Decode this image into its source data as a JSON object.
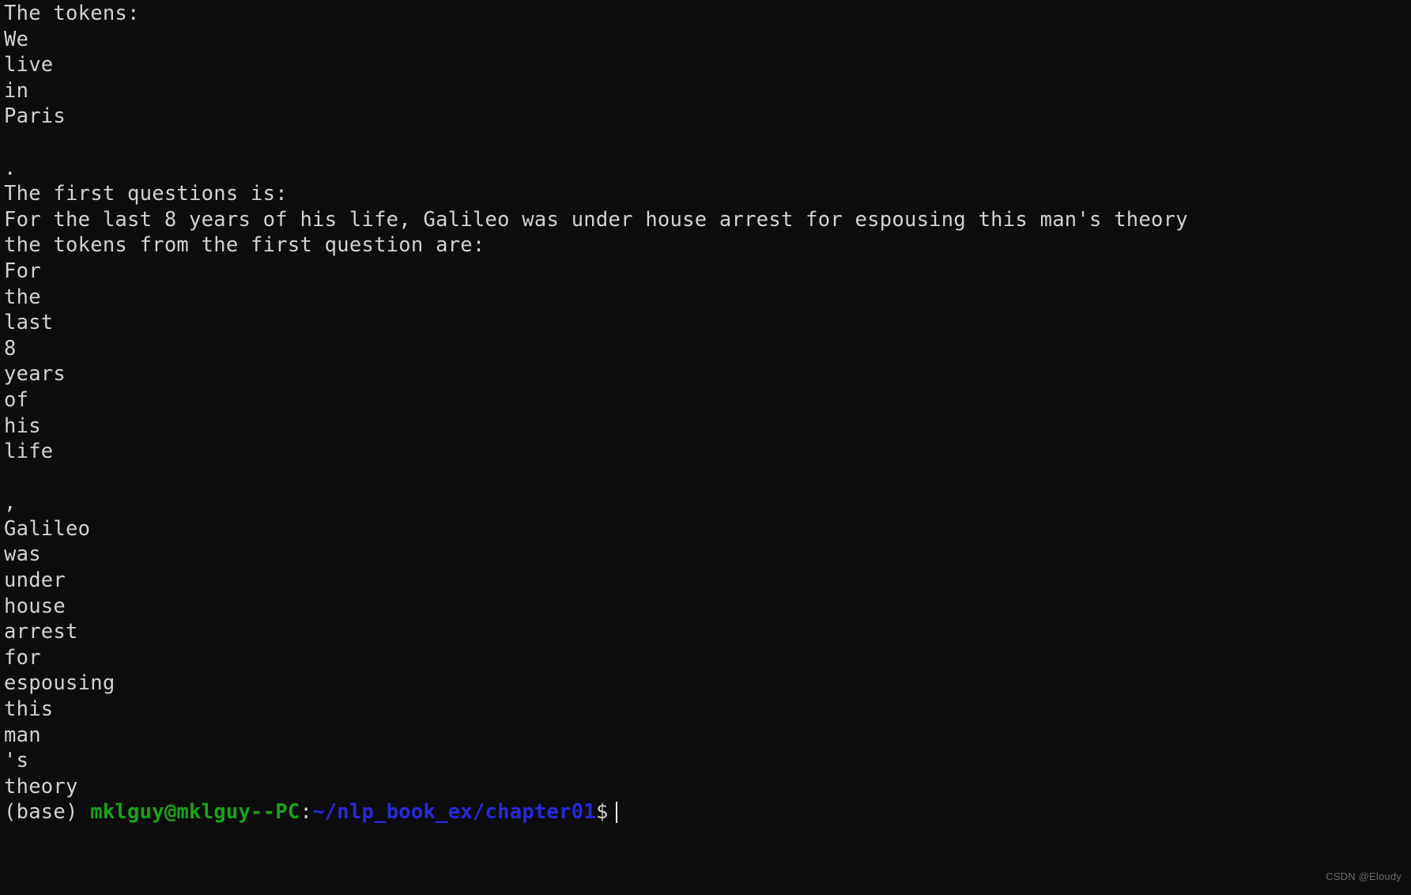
{
  "terminal": {
    "background_color": "#0d0d0d",
    "text_color": "#d2d2d2",
    "user_host_color": "#19a319",
    "path_color": "#2828e0",
    "cursor_color": "#efefef",
    "lines": [
      "The tokens:",
      "We",
      "live",
      "in",
      "Paris",
      "",
      ".",
      "The first questions is:",
      "For the last 8 years of his life, Galileo was under house arrest for espousing this man's theory",
      "the tokens from the first question are:",
      "For",
      "the",
      "last",
      "8",
      "years",
      "of",
      "his",
      "life",
      "",
      ",",
      "Galileo",
      "was",
      "under",
      "house",
      "arrest",
      "for",
      "espousing",
      "this",
      "man",
      "'s",
      "theory"
    ]
  },
  "prompt": {
    "env": "(base) ",
    "user_host": "mklguy@mklguy--PC",
    "colon": ":",
    "path": "~/nlp_book_ex/chapter01",
    "dollar": "$"
  },
  "watermark": {
    "text": "CSDN @Eloudy"
  }
}
